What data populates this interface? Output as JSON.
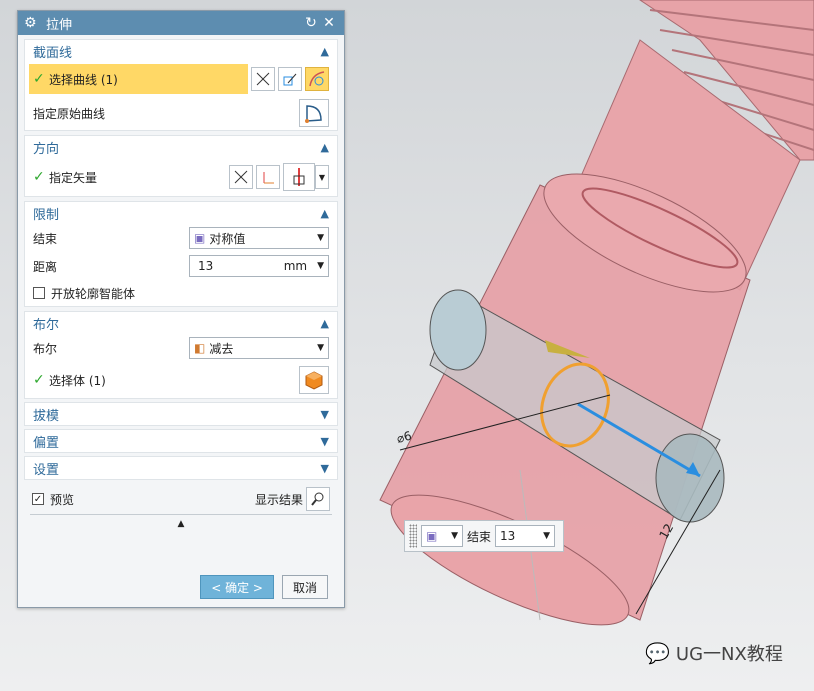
{
  "dialog": {
    "title": "拉伸",
    "section": {
      "label": "截面线",
      "select_curve": "选择曲线 (1)",
      "specify_original": "指定原始曲线"
    },
    "direction": {
      "label": "方向",
      "specify_vector": "指定矢量"
    },
    "limits": {
      "label": "限制",
      "end_label": "结束",
      "end_value": "对称值",
      "distance_label": "距离",
      "distance_value": "13",
      "distance_unit": "mm",
      "open_profile_label": "开放轮廓智能体",
      "open_profile_checked": false
    },
    "boolean": {
      "label": "布尔",
      "bool_label": "布尔",
      "bool_value": "减去",
      "select_body": "选择体 (1)"
    },
    "draft": {
      "label": "拔模"
    },
    "offset": {
      "label": "偏置"
    },
    "settings": {
      "label": "设置"
    },
    "preview_label": "预览",
    "preview_checked": true,
    "show_result": "显示结果",
    "ok_label": "< 确定 >",
    "cancel_label": "取消"
  },
  "floatbar": {
    "end_label": "结束",
    "value": "13"
  },
  "viewport": {
    "dim_diameter": "⌀6",
    "dim_length": "12"
  },
  "watermark": "UG一NX教程",
  "colors": {
    "accent": "#5d8db0",
    "highlight": "#ffd866",
    "part_pink": "#e8a3a8",
    "tool_body": "#b8c8d0",
    "vector_blue": "#2a8ee0",
    "curve_orange": "#f0a030"
  }
}
